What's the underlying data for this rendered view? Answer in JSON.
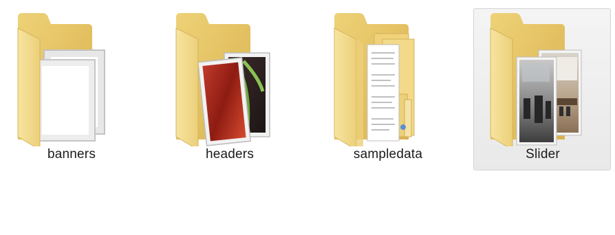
{
  "window": {
    "view": "large-icons"
  },
  "folders": [
    {
      "name": "banners",
      "icon": "folder-banners-icon",
      "selected": false
    },
    {
      "name": "headers",
      "icon": "folder-headers-icon",
      "selected": false
    },
    {
      "name": "sampledata",
      "icon": "folder-sampledata-icon",
      "selected": false
    },
    {
      "name": "Slider",
      "icon": "folder-slider-icon",
      "selected": true
    }
  ],
  "colors": {
    "folder_back": "#e8c763",
    "folder_front": "#f4dc8c",
    "selection_bg": "#ececec",
    "selection_border": "#d3d3d3",
    "label_text": "#1a1a1a"
  }
}
